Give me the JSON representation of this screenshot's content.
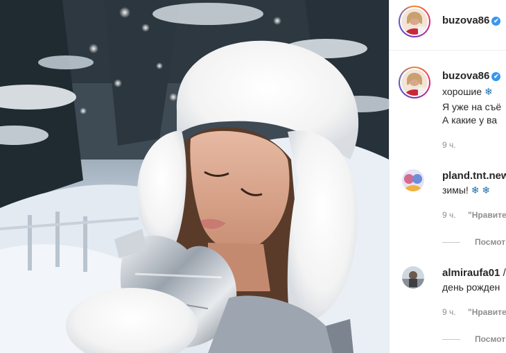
{
  "post": {
    "author": "buzova86",
    "verified_icon": "verified-badge-icon",
    "caption_lines": [
      "хорошие",
      "Я уже на съё",
      "А какие у ва"
    ],
    "caption_emoji": "❄",
    "time": "9 ч."
  },
  "comments": [
    {
      "username": "pland.tnt.new",
      "text": "зимы!",
      "emoji": [
        "❄",
        "❄"
      ],
      "time": "9 ч.",
      "like_label": "\"Нравите",
      "replies_label": "Посмот"
    },
    {
      "username": "almiraufa01",
      "username_suffix": "/",
      "text": "день рожден",
      "time": "9 ч.",
      "like_label": "\"Нравите",
      "replies_label": "Посмотр"
    }
  ],
  "colors": {
    "text": "#262626",
    "muted": "#8e8e8e",
    "verified": "#3897f0",
    "snowflake": "#1e6fa8"
  }
}
